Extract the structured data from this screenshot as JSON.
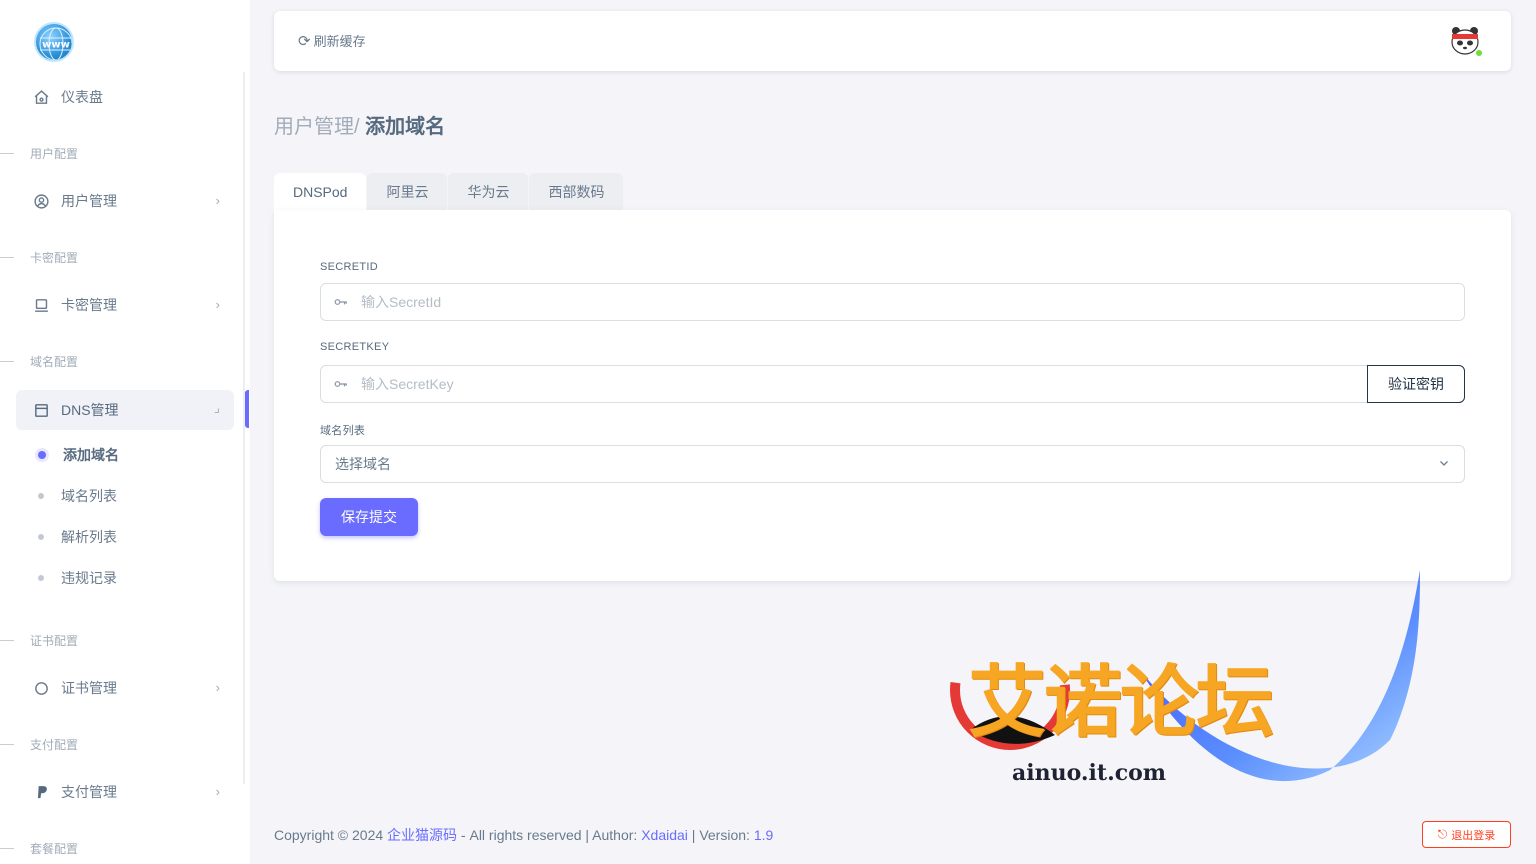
{
  "sidebar": {
    "dashboard": "仪表盘",
    "sections": {
      "user_config": "用户配置",
      "card_config": "卡密配置",
      "domain_config": "域名配置",
      "cert_config": "证书配置",
      "pay_config": "支付配置",
      "package_config": "套餐配置"
    },
    "items": {
      "user_manage": "用户管理",
      "card_manage": "卡密管理",
      "dns_manage": "DNS管理",
      "cert_manage": "证书管理",
      "pay_manage": "支付管理"
    },
    "dns_sub": [
      "添加域名",
      "域名列表",
      "解析列表",
      "违规记录"
    ]
  },
  "navbar": {
    "refresh_label": "刷新缓存"
  },
  "breadcrumb": {
    "parent": "用户管理/",
    "current": "添加域名"
  },
  "tabs": [
    "DNSPod",
    "阿里云",
    "华为云",
    "西部数码"
  ],
  "form": {
    "secretid_label": "SECRETID",
    "secretid_placeholder": "输入SecretId",
    "secretkey_label": "SECRETKEY",
    "secretkey_placeholder": "输入SecretKey",
    "verify_label": "验证密钥",
    "domain_list_label": "域名列表",
    "domain_select_value": "选择域名",
    "save_label": "保存提交"
  },
  "watermark": {
    "title": "艾诺论坛",
    "url": "ainuo.it.com"
  },
  "footer": {
    "copyright": "Copyright © 2024",
    "brand": "企业猫源码",
    "rights": " - All rights reserved | Author: ",
    "author": "Xdaidai",
    "version_label": " | Version: ",
    "version": "1.9",
    "logout_label": "退出登录"
  },
  "colors": {
    "primary": "#696cff",
    "danger": "#ff3e1d",
    "watermark": "#f6a623"
  }
}
